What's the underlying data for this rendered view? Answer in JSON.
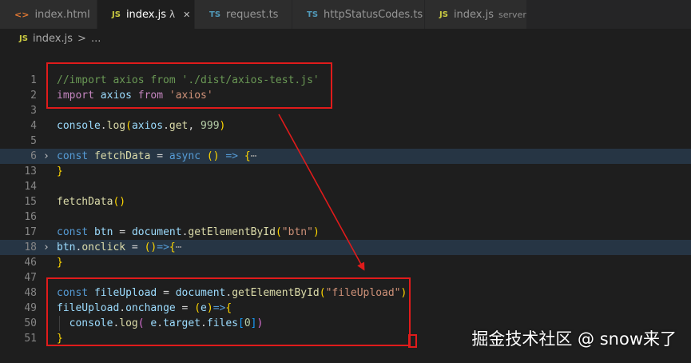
{
  "tabs": [
    {
      "icon": "<>",
      "label": "index.html",
      "indicator": "dot"
    },
    {
      "icon": "JS",
      "label": "index.js",
      "suffix": "λ",
      "close": "✕",
      "active": true
    },
    {
      "icon": "TS",
      "label": "request.ts"
    },
    {
      "icon": "TS",
      "label": "httpStatusCodes.ts"
    },
    {
      "icon": "JS",
      "label": "index.js",
      "description": "server"
    }
  ],
  "breadcrumb": {
    "icon": "JS",
    "file": "index.js",
    "separator": ">",
    "more": "..."
  },
  "code_lines": [
    {
      "num": "1",
      "text": "//import axios from './dist/axios-test.js'"
    },
    {
      "num": "2",
      "text": "import axios from 'axios'"
    },
    {
      "num": "3",
      "text": ""
    },
    {
      "num": "4",
      "text": "console.log(axios.get, 999)"
    },
    {
      "num": "5",
      "text": ""
    },
    {
      "num": "6",
      "text": "const fetchData = async () => {⋯",
      "folded": true
    },
    {
      "num": "13",
      "text": "}"
    },
    {
      "num": "14",
      "text": ""
    },
    {
      "num": "15",
      "text": "fetchData()"
    },
    {
      "num": "16",
      "text": ""
    },
    {
      "num": "17",
      "text": "const btn = document.getElementById(\"btn\")"
    },
    {
      "num": "18",
      "text": "btn.onclick = ()=>{⋯",
      "folded": true
    },
    {
      "num": "46",
      "text": "}"
    },
    {
      "num": "47",
      "text": ""
    },
    {
      "num": "48",
      "text": "const fileUpload = document.getElementById(\"fileUpload\")"
    },
    {
      "num": "49",
      "text": "fileUpload.onchange = (e)=>{"
    },
    {
      "num": "50",
      "text": "  console.log( e.target.files[0])"
    },
    {
      "num": "51",
      "text": "}"
    }
  ],
  "fold_icon": "›",
  "watermark": "掘金技术社区 @ snow来了",
  "colors": {
    "annotation": "#e01b1b",
    "editor_bg": "#1e1e1e",
    "line_highlight": "#263544"
  }
}
